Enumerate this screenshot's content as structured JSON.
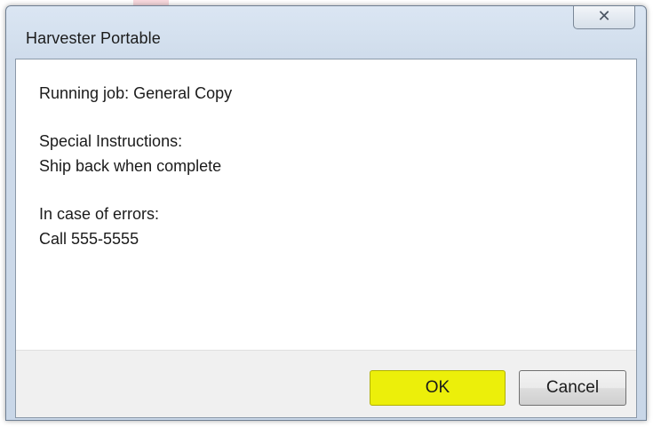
{
  "dialog": {
    "title": "Harvester Portable",
    "close_glyph": "✕"
  },
  "message": {
    "job_line": "Running job: General Copy",
    "special_heading": "Special Instructions:",
    "special_text": "Ship back when complete",
    "errors_heading": "In case of errors:",
    "errors_text": "Call 555-5555"
  },
  "buttons": {
    "ok_label": "OK",
    "cancel_label": "Cancel"
  },
  "colors": {
    "highlight": "#f4f400",
    "ok_border": "#3c7fb1"
  }
}
